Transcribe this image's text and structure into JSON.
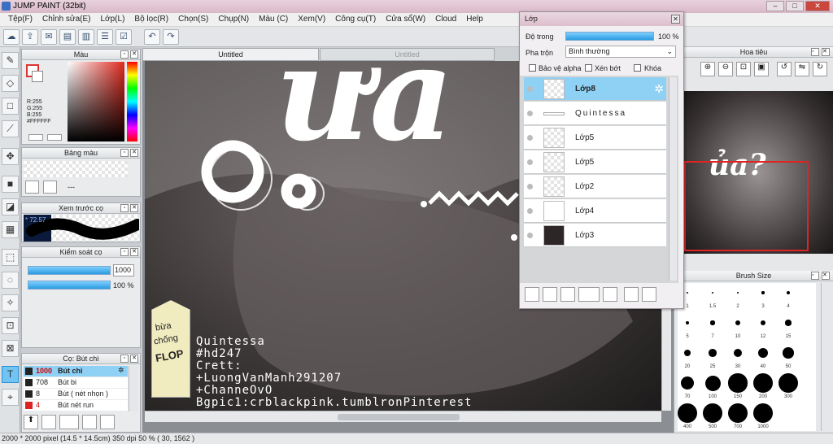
{
  "app": {
    "title": "JUMP PAINT (32bit)"
  },
  "menu": [
    "Tệp(F)",
    "Chỉnh sửa(E)",
    "Lớp(L)",
    "Bộ lọc(R)",
    "Chọn(S)",
    "Chụp(N)",
    "Màu (C)",
    "Xem(V)",
    "Công cụ(T)",
    "Cửa sổ(W)",
    "Cloud",
    "Help"
  ],
  "panels": {
    "color": {
      "title": "Màu",
      "r": "R:255",
      "g": "G:255",
      "b": "B:255",
      "hex": "#FFFFFF"
    },
    "palette": {
      "title": "Bảng màu",
      "dashes": "---"
    },
    "brush_preview": {
      "title": "Xem trước cọ",
      "value": "* 72.57"
    },
    "brush_control": {
      "title": "Kiểm soát cọ",
      "size": "1000",
      "opacity": "100 %",
      "size_fill": 1.0,
      "opacity_fill": 1.0
    },
    "brush_list": {
      "title": "Cọ: Bút chì",
      "items": [
        {
          "size": "1000",
          "name": "Bút chì",
          "selected": true
        },
        {
          "size": "708",
          "name": "Bút bi"
        },
        {
          "size": "8",
          "name": "Bút ( nét nhọn )"
        },
        {
          "size": "4",
          "name": "Bút nét run"
        }
      ]
    }
  },
  "tabs": [
    "Untitled",
    "Untitled"
  ],
  "artwork": {
    "big_text": "ưa",
    "credits": [
      "Quintessa",
      "#hd247",
      "Crett:",
      "+LuongVanManh291207",
      "+ChanneOvO",
      "Bgpic1:crblackpink.tumblronPinterest"
    ],
    "tag_text": [
      "bừa",
      "chống",
      "FLOP"
    ]
  },
  "layer_window": {
    "title": "Lớp",
    "opacity_label": "Độ trong",
    "opacity_value": "100 %",
    "opacity_fill": 1.0,
    "blend_label": "Pha trộn",
    "blend_value": "Bình thường",
    "protect_alpha": "Bảo vệ alpha",
    "clip": "Xén bớt",
    "lock": "Khóa",
    "layers": [
      {
        "name": "Lớp8",
        "selected": true
      },
      {
        "name": "Quintessa"
      },
      {
        "name": "Lớp5"
      },
      {
        "name": "Lớp5"
      },
      {
        "name": "Lớp2"
      },
      {
        "name": "Lớp4"
      },
      {
        "name": "Lớp3"
      }
    ]
  },
  "navigator": {
    "title": "Hoa tiêu",
    "preview_text": "ủa?"
  },
  "brush_size": {
    "title": "Brush Size",
    "sizes": [
      "1",
      "1.5",
      "2",
      "3",
      "4",
      "5",
      "7",
      "10",
      "12",
      "15",
      "20",
      "25",
      "30",
      "40",
      "50",
      "70",
      "100",
      "150",
      "200",
      "300",
      "400",
      "500",
      "700",
      "1000"
    ]
  },
  "status": {
    "text": "2000 * 2000 pixel   (14.5 * 14.5cm)   350 dpi   50 %   ( 30, 1562 )"
  }
}
